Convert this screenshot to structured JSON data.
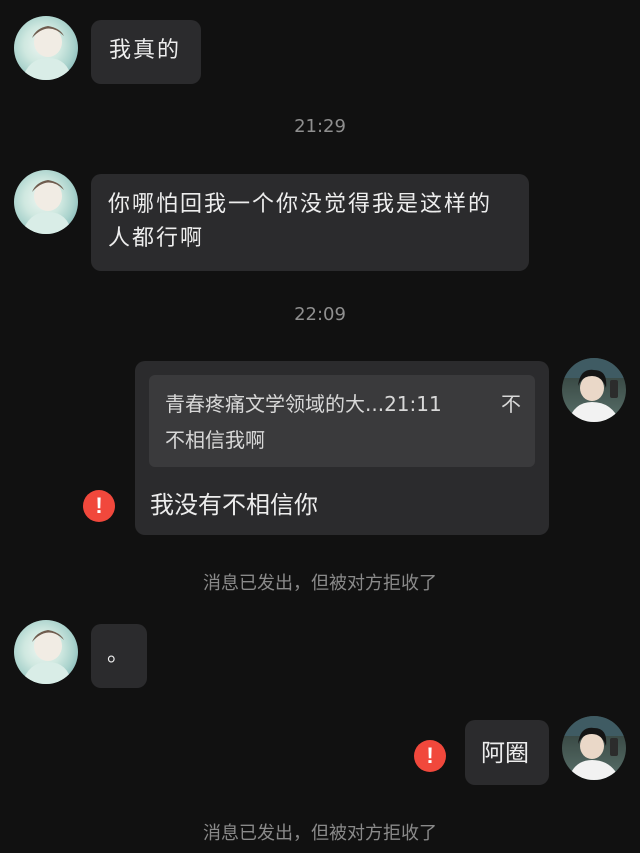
{
  "avatars": {
    "contact_icon": "contact-avatar-icon",
    "self_icon": "self-avatar-icon"
  },
  "messages": [
    {
      "text": "我真的"
    },
    {
      "text": "你哪怕回我一个你没觉得我是这样的人都行啊"
    },
    {
      "quote": {
        "source": "青春疼痛文学领域的大...21:11",
        "text_part1": "不",
        "text_part2": "不相信我啊"
      },
      "text": "我没有不相信你"
    },
    {
      "text": "。"
    },
    {
      "text": "阿圈"
    }
  ],
  "timestamps": [
    "21:29",
    "22:09"
  ],
  "notices": {
    "rejected": "消息已发出，但被对方拒收了"
  },
  "icons": {
    "error": "!"
  },
  "colors": {
    "background": "#111111",
    "bubble": "#2b2b2d",
    "quote_box": "#3a3a3c",
    "error_red": "#f1483c",
    "secondary_text": "#8a8a8a"
  }
}
